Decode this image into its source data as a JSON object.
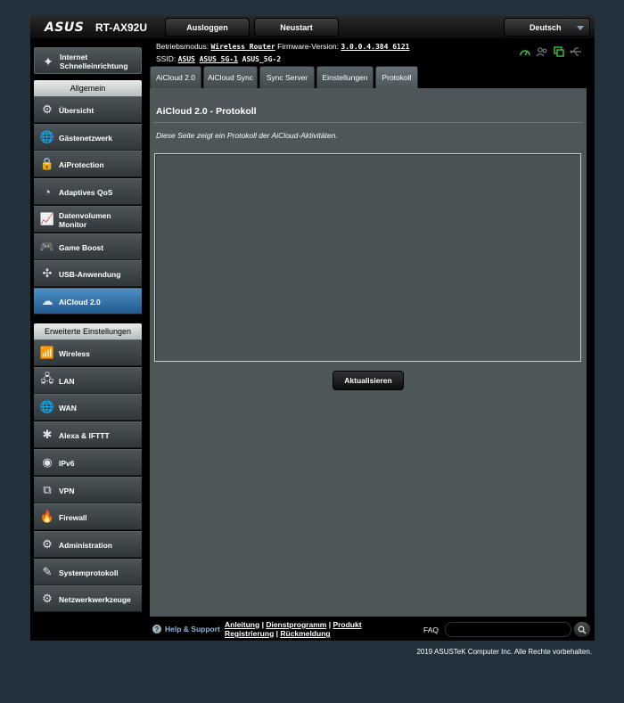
{
  "brand": {
    "logo": "ASUS",
    "model": "RT-AX92U"
  },
  "topbar": {
    "logout_label": "Ausloggen",
    "restart_label": "Neustart",
    "language": "Deutsch"
  },
  "info": {
    "mode_label": "Betriebsmodus:",
    "mode_value": "Wireless Router",
    "fw_label": "Firmware-Version:",
    "fw_value": "3.0.0.4.384_6121",
    "ssid_label": "SSID:",
    "ssids": [
      "ASUS",
      "ASUS_5G-1",
      "ASUS_5G-2"
    ]
  },
  "status_icons": [
    "gauge-icon",
    "clients-icon",
    "usb-device-icon",
    "usb-icon"
  ],
  "sidebar": {
    "qis": {
      "label": "Internet Schnelleinrichtung",
      "icon": "wand-icon"
    },
    "general_header": "Allgemein",
    "general_items": [
      {
        "label": "Übersicht",
        "icon": "network-map-icon",
        "glyph": "⚙"
      },
      {
        "label": "Gästenetzwerk",
        "icon": "globe-icon",
        "glyph": "🌐"
      },
      {
        "label": "AiProtection",
        "icon": "lock-icon",
        "glyph": "🔒"
      },
      {
        "label": "Adaptives QoS",
        "icon": "gauge-icon",
        "glyph": "◔"
      },
      {
        "label": "Datenvolumen Monitor",
        "icon": "chart-icon",
        "glyph": "📈"
      },
      {
        "label": "Game Boost",
        "icon": "gamepad-icon",
        "glyph": "🎮"
      },
      {
        "label": "USB-Anwendung",
        "icon": "puzzle-icon",
        "glyph": "✣"
      },
      {
        "label": "AiCloud 2.0",
        "icon": "cloud-icon",
        "glyph": "☁",
        "active": true
      }
    ],
    "advanced_header": "Erweiterte Einstellungen",
    "advanced_items": [
      {
        "label": "Wireless",
        "icon": "wireless-icon",
        "glyph": "📶"
      },
      {
        "label": "LAN",
        "icon": "lan-icon",
        "glyph": "🖧"
      },
      {
        "label": "WAN",
        "icon": "wan-globe-icon",
        "glyph": "🌐"
      },
      {
        "label": "Alexa & IFTTT",
        "icon": "alexa-icon",
        "glyph": "✱"
      },
      {
        "label": "IPv6",
        "icon": "ipv6-icon",
        "glyph": "◉"
      },
      {
        "label": "VPN",
        "icon": "vpn-icon",
        "glyph": "⧉"
      },
      {
        "label": "Firewall",
        "icon": "fire-icon",
        "glyph": "🔥"
      },
      {
        "label": "Administration",
        "icon": "gear-icon",
        "glyph": "⚙"
      },
      {
        "label": "Systemprotokoll",
        "icon": "log-icon",
        "glyph": "✎"
      },
      {
        "label": "Netzwerkwerkzeuge",
        "icon": "tools-icon",
        "glyph": "⚙"
      }
    ]
  },
  "tabs": [
    {
      "label": "AiCloud 2.0"
    },
    {
      "label": "AiCloud Sync"
    },
    {
      "label": "Sync Server"
    },
    {
      "label": "Einstellungen"
    },
    {
      "label": "Protokoll",
      "active": true
    }
  ],
  "main": {
    "title": "AiCloud 2.0 - Protokoll",
    "description": "Diese Seite zeigt ein Protokoll der AiCloud-Aktivitäten.",
    "log_text": "",
    "refresh_label": "Aktualisieren"
  },
  "footer": {
    "help_label": "Help & Support",
    "links": [
      "Anleitung",
      "Dienstprogramm",
      "Produkt Registrierung",
      "Rückmeldung"
    ],
    "faq_label": "FAQ",
    "copyright": "2019 ASUSTeK Computer Inc. Alle Rechte vorbehalten."
  }
}
